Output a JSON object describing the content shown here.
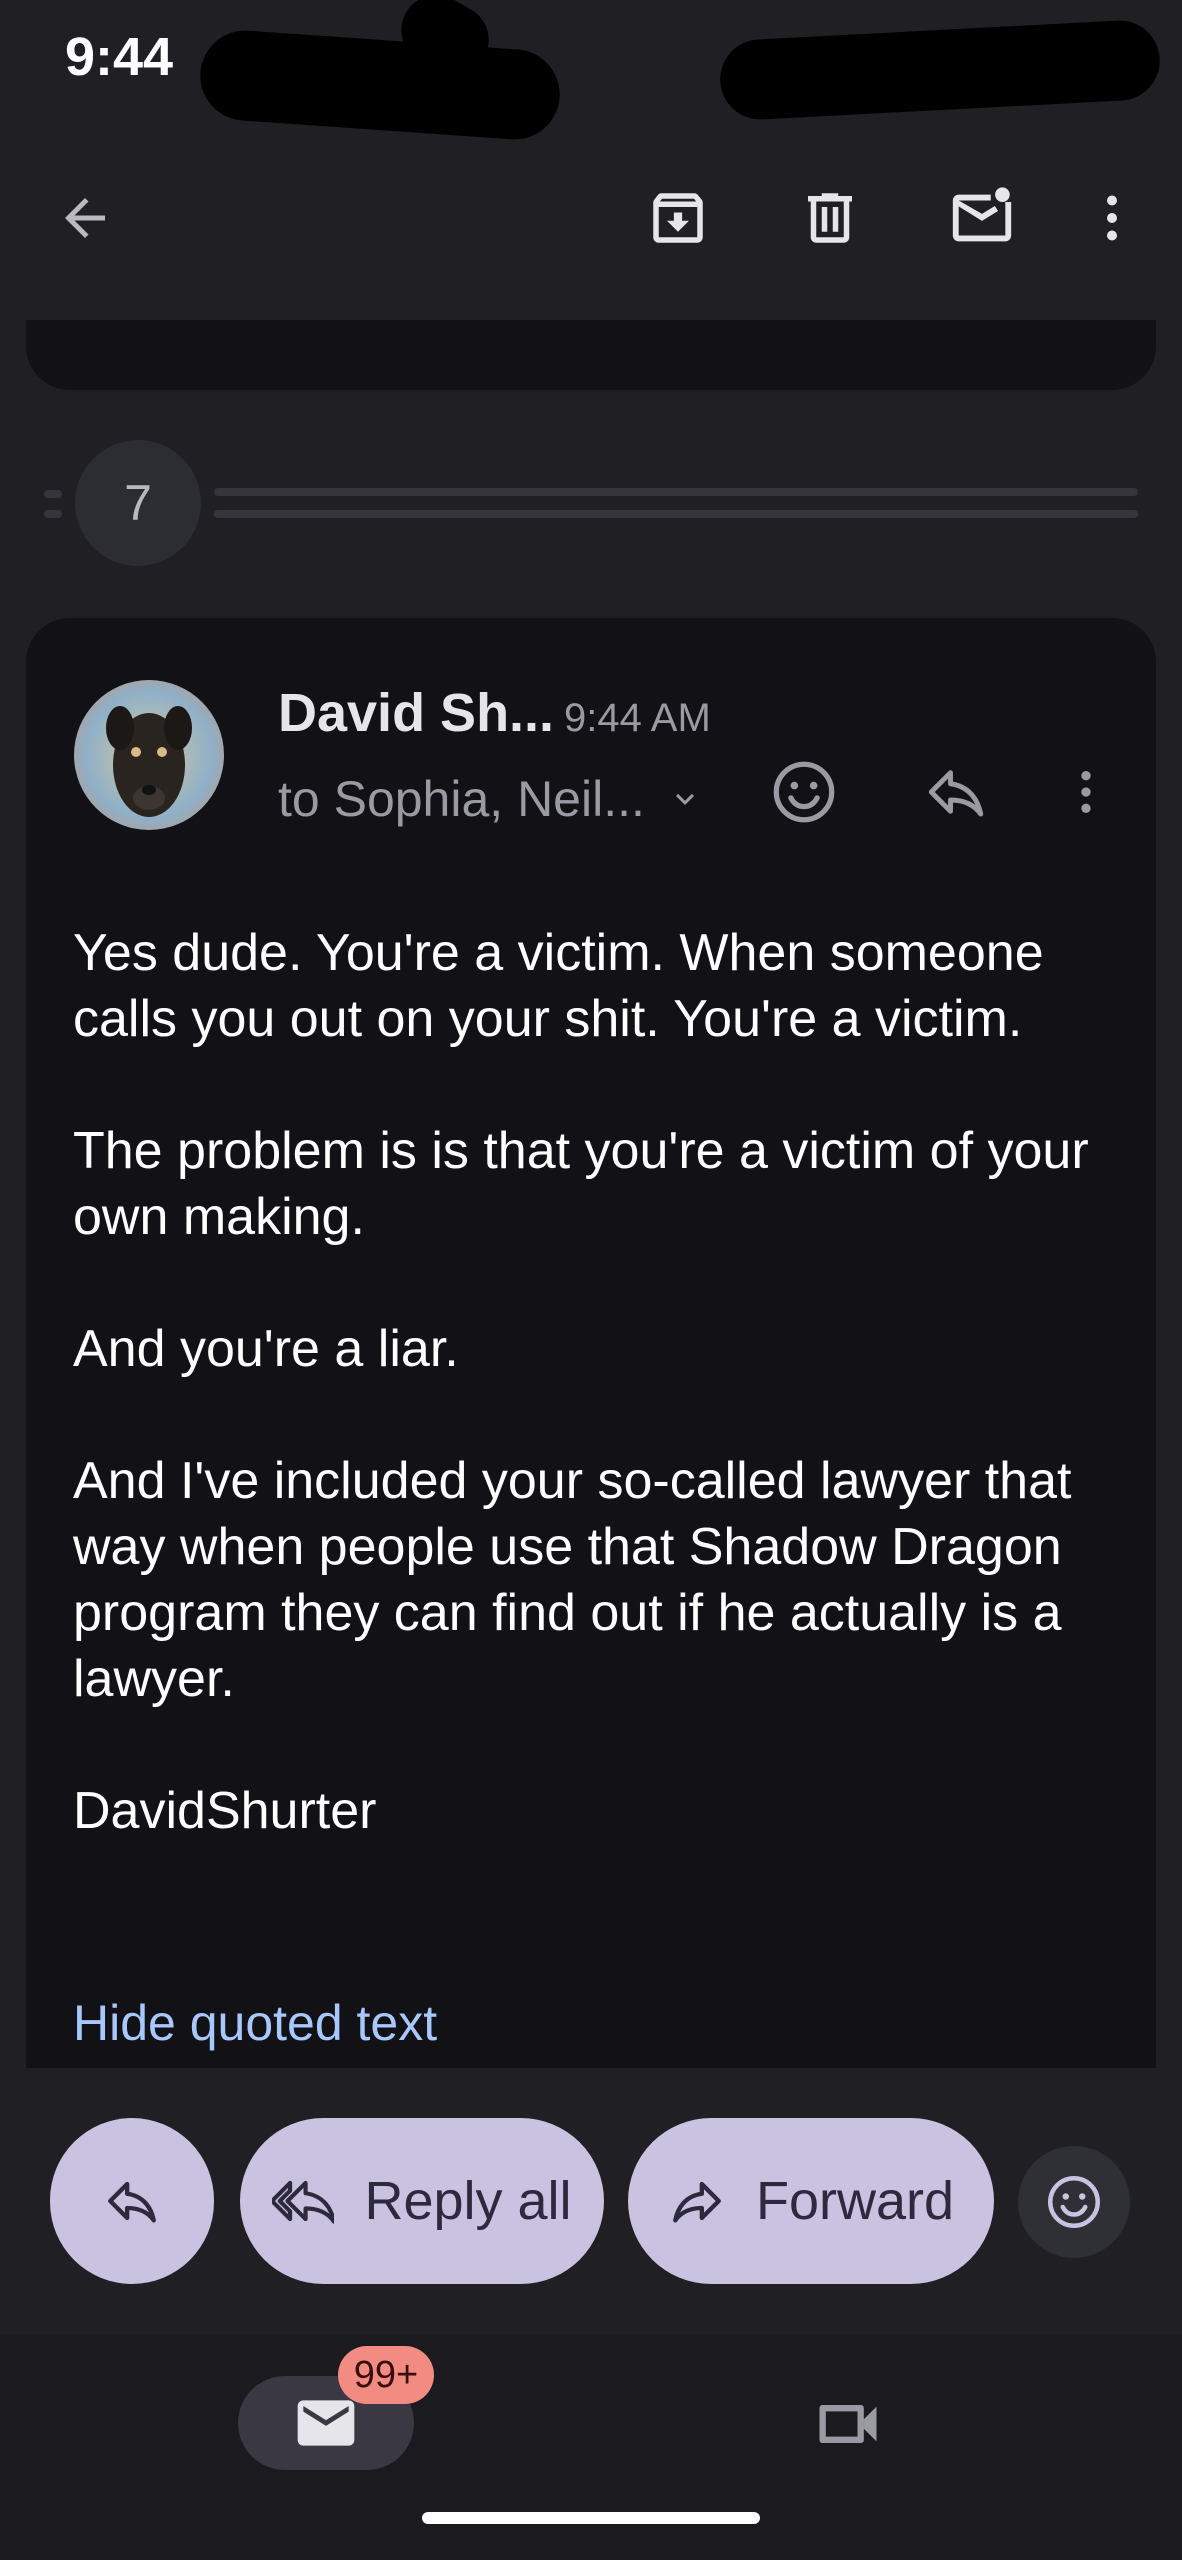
{
  "status_bar": {
    "time": "9:44"
  },
  "app_bar": {
    "back_icon": "arrow-back-icon",
    "archive_icon": "archive-icon",
    "delete_icon": "delete-icon",
    "mark_unread_icon": "mark-unread-icon",
    "more_icon": "more-vert-icon"
  },
  "thread": {
    "collapsed_count": "7"
  },
  "message": {
    "sender": "David Sh...",
    "time": "9:44 AM",
    "recipients": "to Sophia, Neil...",
    "body": [
      "Yes dude. You're a victim. When someone calls you out on your shit. You're a victim.",
      "The problem is is that you're a victim of your own making.",
      "And you're a liar.",
      "And I've included your so-called lawyer that way when people use that Shadow Dragon program they can find out if he actually is a lawyer.",
      "DavidShurter"
    ],
    "hide_quoted": "Hide quoted text"
  },
  "actions": {
    "reply_all": "Reply all",
    "forward": "Forward"
  },
  "bottom_nav": {
    "mail_badge": "99+"
  },
  "colors": {
    "background": "#1f1f24",
    "card": "#111116",
    "pill": "#c9c2e0",
    "link": "#a8c7fa",
    "badge": "#f28b82"
  }
}
